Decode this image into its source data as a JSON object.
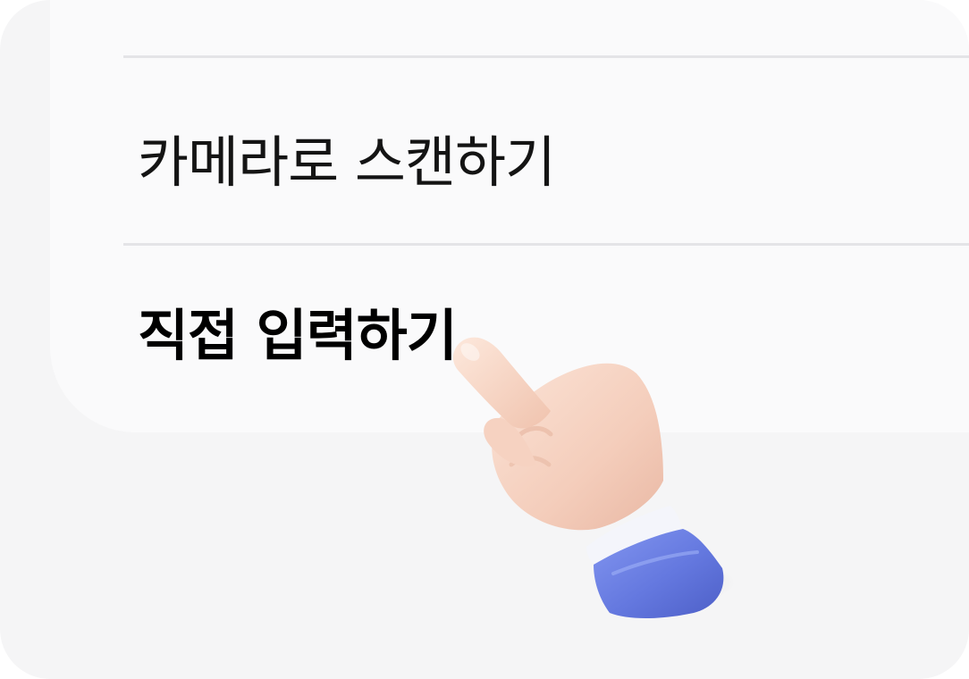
{
  "menu": {
    "items": [
      {
        "label": "카메라로 스캔하기",
        "emphasized": false
      },
      {
        "label": "직접 입력하기",
        "emphasized": true
      }
    ]
  },
  "pointer": {
    "icon": "pointing-hand-icon",
    "target": "직접 입력하기"
  },
  "colors": {
    "background": "#f5f5f6",
    "sheet": "#fafafb",
    "divider": "#e4e4e7",
    "text": "#141414",
    "sleeve": "#6b7fe3",
    "skin": "#f6d6c6"
  }
}
